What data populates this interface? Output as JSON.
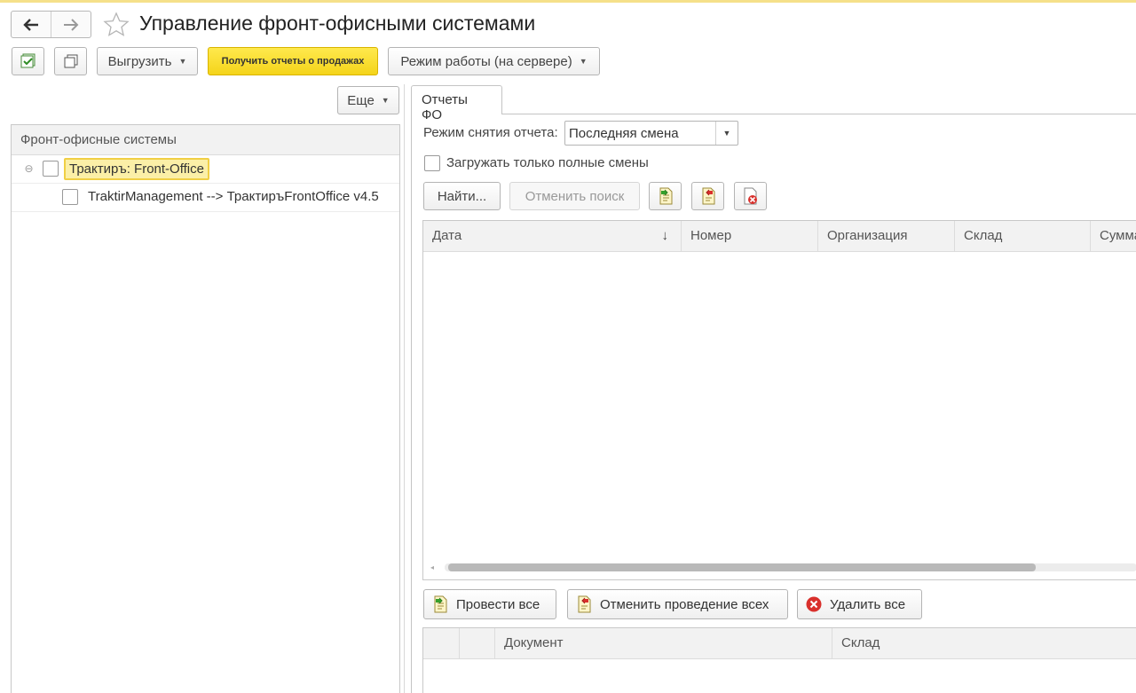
{
  "window": {
    "title": "Управление фронт-офисными системами"
  },
  "toolbar": {
    "export_label": "Выгрузить",
    "get_reports_label": "Получить отчеты о продажах",
    "mode_label": "Режим работы (на сервере)"
  },
  "left": {
    "more_label": "Еще",
    "column_header": "Фронт-офисные системы",
    "tree": [
      {
        "label": "Трактиръ: Front-Office",
        "expanded": true,
        "selected": true
      },
      {
        "label": "TraktirManagement --> ТрактиръFrontOffice v4.5"
      }
    ]
  },
  "right": {
    "tab_label": "Отчеты ФО",
    "report_mode_label": "Режим снятия отчета:",
    "report_mode_value": "Последняя смена",
    "full_shifts_label": "Загружать только полные смены",
    "find_label": "Найти...",
    "cancel_search_label": "Отменить поиск",
    "table": {
      "columns": [
        "Дата",
        "Номер",
        "Организация",
        "Склад",
        "Сумма"
      ],
      "sort_indicator": "↓"
    },
    "actions": {
      "post_all": "Провести все",
      "unpost_all": "Отменить проведение всех",
      "delete_all": "Удалить все"
    },
    "table2": {
      "columns": [
        "",
        "",
        "Документ",
        "Склад"
      ]
    }
  },
  "colors": {
    "accent_yellow": "#f4d41a",
    "selection_fill": "#fbefa7",
    "selection_border": "#f0cf45",
    "delete_red": "#d9302c"
  }
}
